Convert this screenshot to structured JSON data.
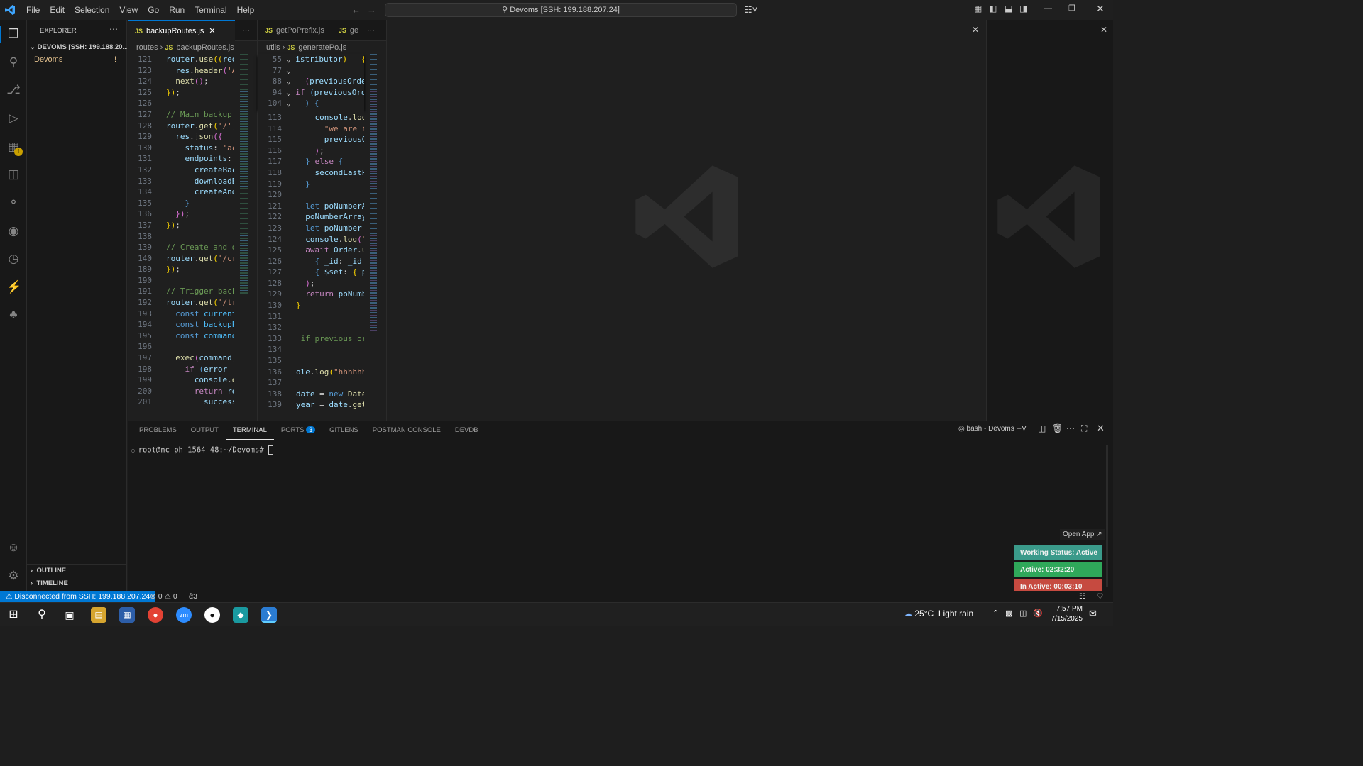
{
  "menu": [
    "File",
    "Edit",
    "Selection",
    "View",
    "Go",
    "Run",
    "Terminal",
    "Help"
  ],
  "command_center": "Devoms [SSH: 199.188.207.24]",
  "sidebar": {
    "title": "EXPLORER",
    "root": "DEVOMS [SSH: 199.188.20...",
    "folder": "Devoms",
    "folder_badge": "!",
    "outline": "OUTLINE",
    "timeline": "TIMELINE"
  },
  "group1": {
    "tabs": [
      "backupRoutes.js"
    ],
    "breadcrumb": [
      "routes",
      "backupRoutes.js"
    ],
    "lines": [
      {
        "n": "121",
        "html": "<span class='vr'>router</span>.<span class='fn'>use</span><span class='yl'>((</span><span class='vr'>req</span>"
      },
      {
        "n": "123",
        "html": "  <span class='vr'>res</span>.<span class='fn'>header</span><span class='pk'>(</span><span class='str'>'A</span>"
      },
      {
        "n": "124",
        "html": "  <span class='fn'>next</span><span class='pk'>()</span>;"
      },
      {
        "n": "125",
        "html": "<span class='yl'>})</span>;"
      },
      {
        "n": "126",
        "html": ""
      },
      {
        "n": "127",
        "html": "<span class='cm'>// Main backup</span>"
      },
      {
        "n": "128",
        "html": "<span class='vr'>router</span>.<span class='fn'>get</span><span class='yl'>(</span><span class='str'>'/'</span>,"
      },
      {
        "n": "129",
        "html": "  <span class='vr'>res</span>.<span class='fn'>json</span><span class='pk'>({</span>"
      },
      {
        "n": "130",
        "html": "    <span class='vr'>status</span>: <span class='str'>'ac</span>"
      },
      {
        "n": "131",
        "html": "    <span class='vr'>endpoints</span>:"
      },
      {
        "n": "132",
        "html": "      <span class='vr'>createBac</span>"
      },
      {
        "n": "133",
        "html": "      <span class='vr'>downloadB</span>"
      },
      {
        "n": "134",
        "html": "      <span class='vr'>createAnd</span>"
      },
      {
        "n": "135",
        "html": "    <span class='bl'>}</span>"
      },
      {
        "n": "136",
        "html": "  <span class='pk'>})</span>;"
      },
      {
        "n": "137",
        "html": "<span class='yl'>})</span>;"
      },
      {
        "n": "138",
        "html": ""
      },
      {
        "n": "139",
        "html": "<span class='cm'>// Create and d</span>"
      },
      {
        "n": "140",
        "html": "<span class='vr'>router</span>.<span class='fn'>get</span><span class='yl'>(</span><span class='str'>'/cr</span>"
      },
      {
        "n": "189",
        "html": "<span class='yl'>})</span>;"
      },
      {
        "n": "190",
        "html": ""
      },
      {
        "n": "191",
        "html": "<span class='cm'>// Trigger back</span>"
      },
      {
        "n": "192",
        "html": "<span class='vr'>router</span>.<span class='fn'>get</span><span class='yl'>(</span><span class='str'>'/tr</span>"
      },
      {
        "n": "193",
        "html": "  <span class='bl'>const</span> <span class='cy'>current</span>"
      },
      {
        "n": "194",
        "html": "  <span class='bl'>const</span> <span class='cy'>backupP</span>"
      },
      {
        "n": "195",
        "html": "  <span class='bl'>const</span> <span class='cy'>command</span>"
      },
      {
        "n": "196",
        "html": ""
      },
      {
        "n": "197",
        "html": "  <span class='fn'>exec</span><span class='pk'>(</span><span class='vr'>command</span>,"
      },
      {
        "n": "198",
        "html": "    <span class='kw'>if</span> <span class='bl'>(</span><span class='vr'>error</span> |"
      },
      {
        "n": "199",
        "html": "      <span class='vr'>console</span>.<span class='fn'>e</span>"
      },
      {
        "n": "200",
        "html": "      <span class='kw'>return</span> <span class='vr'>re</span>"
      },
      {
        "n": "201",
        "html": "        <span class='vr'>success</span>"
      }
    ]
  },
  "group2": {
    "tabs": [
      "getPoPrefix.js",
      "ge"
    ],
    "breadcrumb": [
      "utils",
      "generatePo.js"
    ],
    "sticky": [
      {
        "n": "55",
        "html": "<span class='vr'>istributor</span><span class='yl'>)</span>   <span class='yl'>{</span>"
      },
      {
        "n": "77",
        "html": ""
      },
      {
        "n": "88",
        "html": "  <span class='pk'>(</span><span class='vr'>previousOrder</span>"
      },
      {
        "n": "94",
        "html": "<span class='kw'>if</span> <span class='bl'>(</span><span class='vr'>previousOrd</span>"
      },
      {
        "n": "104",
        "html": "  <span class='bl'>)</span> <span class='bl'>{</span>"
      }
    ],
    "lines": [
      {
        "n": "113",
        "html": "    <span class='vr'>console</span>.<span class='fn'>log</span>"
      },
      {
        "n": "114",
        "html": "      <span class='str'>\"we are i</span>"
      },
      {
        "n": "115",
        "html": "      <span class='vr'>previousO</span>"
      },
      {
        "n": "116",
        "html": "    <span class='pk'>)</span>;"
      },
      {
        "n": "117",
        "html": "  <span class='bl'>}</span> <span class='kw'>else</span> <span class='bl'>{</span>"
      },
      {
        "n": "118",
        "html": "    <span class='vr'>secondLastP</span>"
      },
      {
        "n": "119",
        "html": "  <span class='bl'>}</span>"
      },
      {
        "n": "120",
        "html": ""
      },
      {
        "n": "121",
        "html": "  <span class='bl'>let</span> <span class='vr'>poNumberA</span>"
      },
      {
        "n": "122",
        "html": "  <span class='vr'>poNumberArray</span>"
      },
      {
        "n": "123",
        "html": "  <span class='bl'>let</span> <span class='vr'>poNumber</span>"
      },
      {
        "n": "124",
        "html": "  <span class='vr'>console</span>.<span class='fn'>log</span><span class='pk'>(</span><span class='str'>\"</span>"
      },
      {
        "n": "125",
        "html": "  <span class='kw'>await</span> <span class='vr'>Order</span>.<span class='fn'>u</span>"
      },
      {
        "n": "126",
        "html": "    <span class='bl'>{</span> <span class='vr'>_id</span>: <span class='vr'>_id</span>"
      },
      {
        "n": "127",
        "html": "    <span class='bl'>{</span> <span class='vr'>$set</span>: <span class='yl'>{</span> <span class='vr'>p</span>"
      },
      {
        "n": "128",
        "html": "  <span class='pk'>)</span>;"
      },
      {
        "n": "129",
        "html": "  <span class='kw'>return</span> <span class='vr'>poNumb</span>"
      },
      {
        "n": "130",
        "html": "<span class='yl'>}</span>"
      },
      {
        "n": "131",
        "html": ""
      },
      {
        "n": "132",
        "html": ""
      },
      {
        "n": "133",
        "html": " <span class='cm'>if previous or</span>"
      },
      {
        "n": "134",
        "html": ""
      },
      {
        "n": "135",
        "html": ""
      },
      {
        "n": "136",
        "html": "<span class='vr'>ole</span>.<span class='fn'>log</span><span class='yl'>(</span><span class='str'>\"hhhhhh</span>"
      },
      {
        "n": "137",
        "html": ""
      },
      {
        "n": "138",
        "html": "<span class='vr'>date</span> = <span class='bl'>new</span> <span class='fn'>Date</span>"
      },
      {
        "n": "139",
        "html": "<span class='vr'>year</span> = <span class='vr'>date</span>.<span class='fn'>get</span>"
      }
    ]
  },
  "panel": {
    "tabs": [
      "PROBLEMS",
      "OUTPUT",
      "TERMINAL",
      "PORTS",
      "GITLENS",
      "POSTMAN CONSOLE",
      "DEVDB"
    ],
    "ports_badge": "3",
    "terminal_name": "bash - Devoms",
    "prompt": "root@nc-ph-1564-48:~/Devoms#"
  },
  "status": {
    "remote": "Disconnected from SSH: 199.188.207.24",
    "errors": "0",
    "warnings": "0",
    "ports": "3"
  },
  "widget": {
    "open_app": "Open App ↗",
    "working": "Working Status: Active",
    "active": "Active: 02:32:20",
    "inactive": "In Active: 00:03:10",
    "colors": {
      "working": "#3a9a8a",
      "active": "#2fa85a",
      "inactive": "#c64a40"
    }
  },
  "taskbar": {
    "weather": "25°C",
    "weather_text": "Light rain",
    "time": "7:57 PM",
    "date": "7/15/2025"
  },
  "colors": {
    "accent": "#0078d4",
    "remote_bg": "#0078d4"
  }
}
